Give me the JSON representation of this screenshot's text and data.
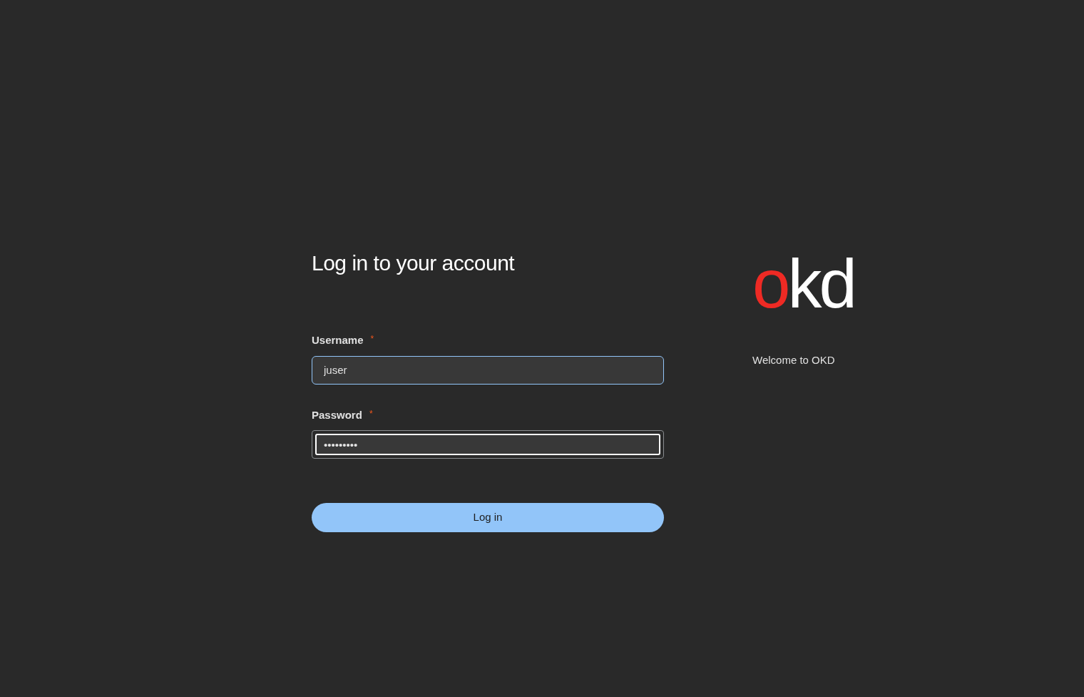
{
  "login": {
    "title": "Log in to your account",
    "fields": [
      {
        "label": "Username",
        "required_mark": "*",
        "value": "juser",
        "hovered": true,
        "focused": false
      },
      {
        "label": "Password",
        "required_mark": "*",
        "value": "•••••••••",
        "hovered": false,
        "focused": true
      }
    ],
    "submit": {
      "label": "Log in"
    }
  },
  "brand": {
    "logo": "okd",
    "welcome": "Welcome to OKD"
  }
}
